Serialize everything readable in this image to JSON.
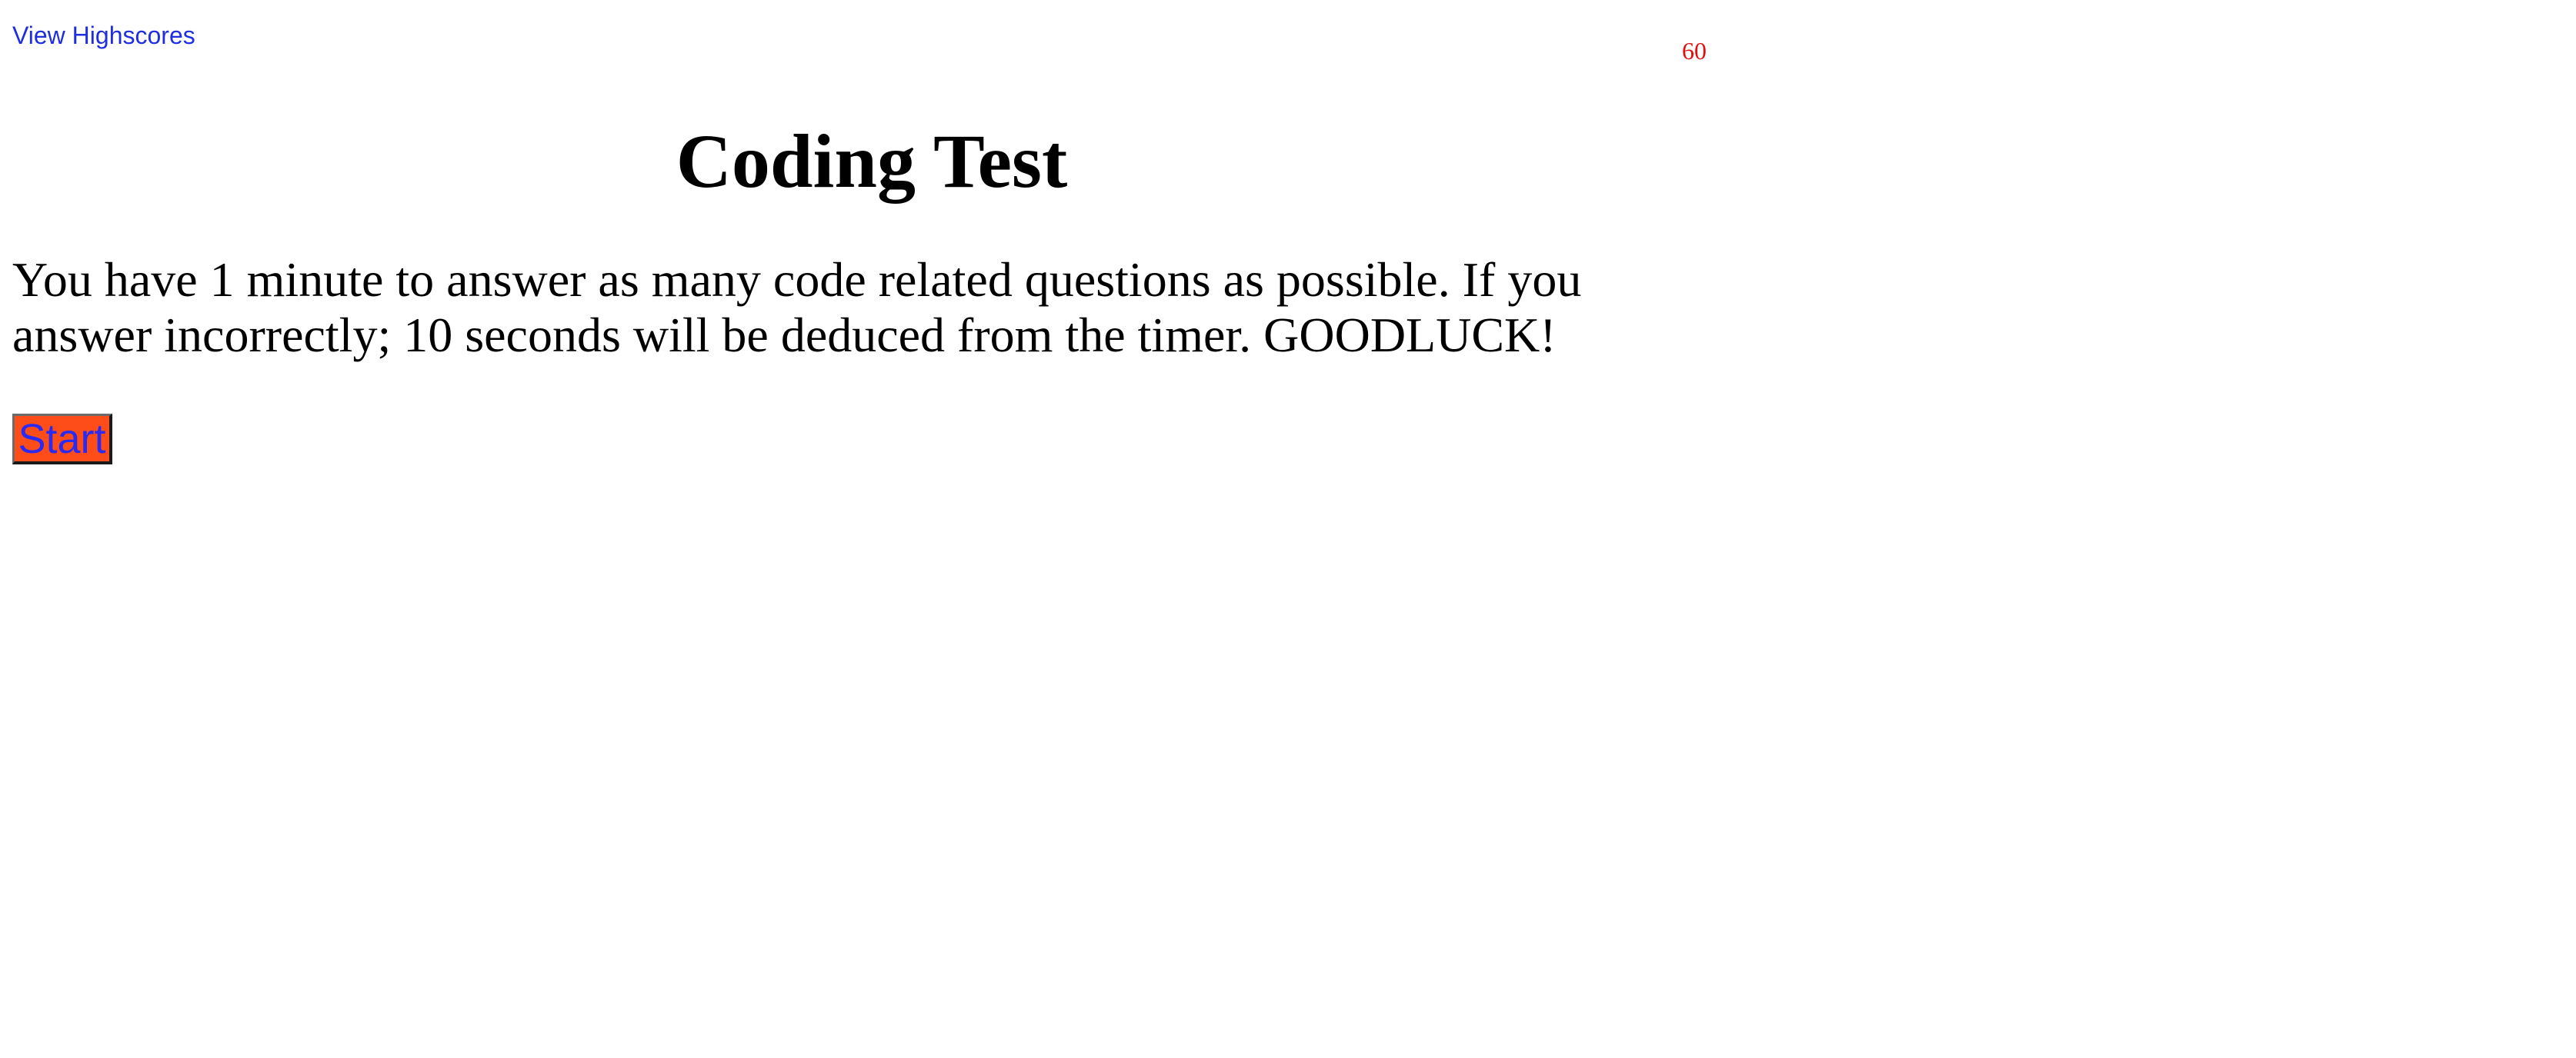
{
  "header": {
    "highscores_link": "View Highscores",
    "timer_value": "60"
  },
  "main": {
    "title": "Coding Test",
    "instructions": "You have 1 minute to answer as many code related questions as possible. If you answer incorrectly; 10 seconds will be deduced from the timer. GOODLUCK!",
    "start_label": "Start"
  },
  "colors": {
    "link": "#1f2fe0",
    "timer": "#e01010",
    "start_button_bg": "#ff4d1a",
    "start_button_text": "#2a2af0"
  }
}
